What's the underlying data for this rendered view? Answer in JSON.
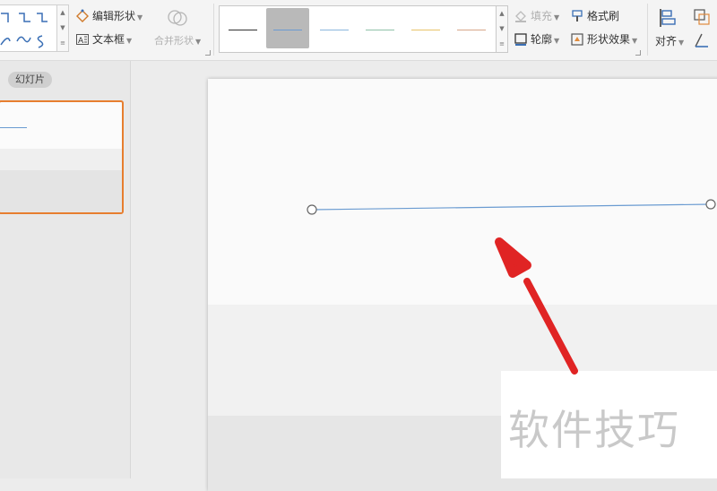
{
  "ribbon": {
    "edit_shape": "编辑形状",
    "text_box": "文本框",
    "merge_shape": "合并形状",
    "fill": "填充",
    "format_painter": "格式刷",
    "outline": "轮廓",
    "shape_effect": "形状效果",
    "align": "对齐",
    "line_styles": [
      {
        "color": "#333333",
        "selected": false
      },
      {
        "color": "#6a9bd1",
        "selected": true
      },
      {
        "color": "#8bb6dd",
        "selected": false
      },
      {
        "color": "#8fc2a8",
        "selected": false
      },
      {
        "color": "#e8c46a",
        "selected": false
      },
      {
        "color": "#d7a68a",
        "selected": false
      }
    ]
  },
  "left_panel": {
    "tab_label": "幻灯片"
  },
  "watermark": {
    "text": "软件技巧"
  },
  "colors": {
    "accent_orange": "#e77e2f",
    "line_blue": "#6a9bd1",
    "arrow_red": "#e02424"
  }
}
